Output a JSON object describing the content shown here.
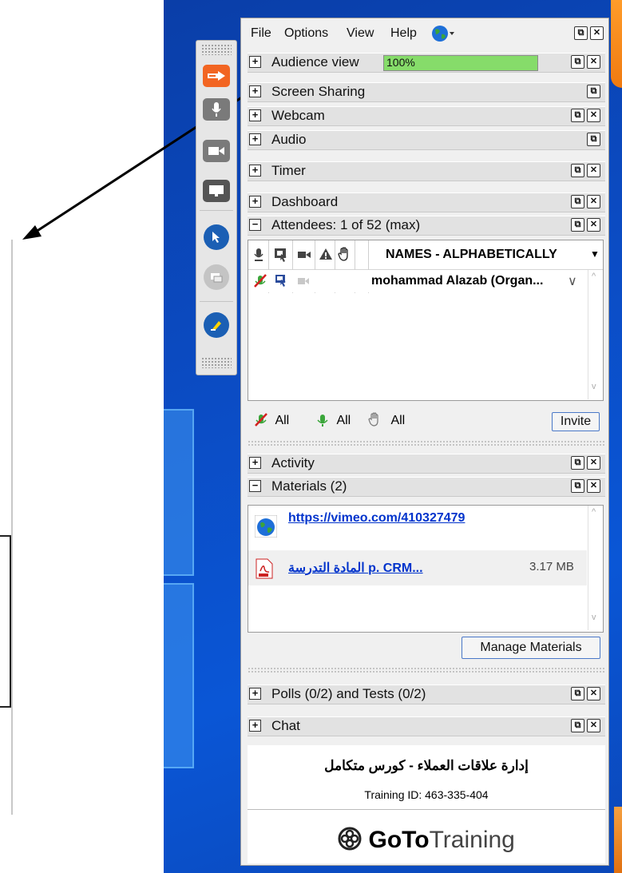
{
  "menu": {
    "file": "File",
    "options": "Options",
    "view": "View",
    "help": "Help"
  },
  "sections": {
    "audience_view": "Audience view",
    "audience_percent": "100%",
    "audience_progress": 1.0,
    "screen_sharing": "Screen Sharing",
    "webcam": "Webcam",
    "audio": "Audio",
    "timer": "Timer",
    "dashboard": "Dashboard",
    "attendees": "Attendees:  1 of 52 (max)",
    "activity": "Activity",
    "materials": "Materials (2)",
    "polls": "Polls (0/2) and Tests (0/2)",
    "chat": "Chat"
  },
  "attendees": {
    "sort_header": "NAMES - ALPHABETICALLY",
    "rows": [
      {
        "name": "mohammad Alazab (Organ..."
      }
    ],
    "mute_all": "All",
    "unmute_all": "All",
    "lower_hands_all": "All",
    "invite": "Invite"
  },
  "materials": {
    "items": [
      {
        "title": "https://vimeo.com/410327479",
        "size": ""
      },
      {
        "title": "...p.  CRM  المادة التدرسة",
        "size": "3.17 MB"
      }
    ],
    "manage_button": "Manage Materials"
  },
  "footer": {
    "training_title": "إدارة علاقات العملاء - كورس متكامل",
    "training_id": "Training ID: 463-335-404",
    "brand_goto": "GoTo",
    "brand_training": "Training"
  },
  "colors": {
    "progress_green": "#86dc6a",
    "link_blue": "#0033cc",
    "toolbar_orange": "#f26522",
    "toolbar_blue": "#1b5fb4"
  },
  "icons": {
    "globe": "globe-icon",
    "pop_out": "pop-out-icon",
    "close": "close-icon"
  }
}
